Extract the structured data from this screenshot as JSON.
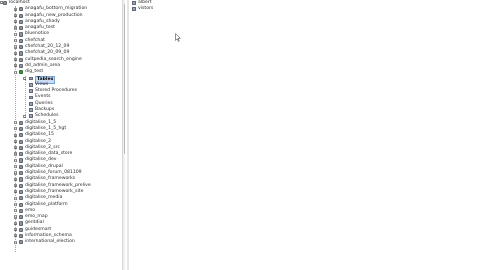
{
  "tree": {
    "root_label": "localhost",
    "databases_before": [
      "anagafu_bottom_migration",
      "anagafu_new_production",
      "anagafu_shady",
      "anagafu_test",
      "bluenotice",
      "chefchat",
      "chefchat_20_12_09",
      "chefchat_20_09_09",
      "cultpedia_search_engine",
      "dd_admin_area"
    ],
    "open_database": "dig_test",
    "children": [
      "Tables",
      "Views",
      "Stored Procedures",
      "Events",
      "Queries",
      "Backups",
      "Schedules"
    ],
    "selected_child": "Tables",
    "databases_after": [
      "digitalise_1_5",
      "digitalise_1_5_hgt",
      "digitalise_15",
      "digitalise_2",
      "digitalise_2_src",
      "digitalise_data_store",
      "digitalise_dev",
      "digitalise_drupal",
      "digitalise_forum_081109",
      "digitalise_frameworks",
      "digitalise_framework_prelive",
      "digitalise_framework_site",
      "digitalise_media",
      "digitalise_platform",
      "emo",
      "emo_map",
      "gentdial",
      "guidesmart",
      "information_schema",
      "international_election"
    ]
  },
  "right_panel": {
    "items": [
      "albert",
      "vistors"
    ]
  },
  "icons": {
    "database": "database-icon",
    "open_database": "database-open-icon",
    "folder": "folder-icon",
    "expand": "expand-icon",
    "collapse": "collapse-icon",
    "cursor": "mouse-cursor-icon"
  },
  "colors": {
    "selection": "#c9dcf5",
    "selection_border": "#7aa3d8",
    "open_db": "#3f9a3a",
    "db": "#8c94a0"
  }
}
